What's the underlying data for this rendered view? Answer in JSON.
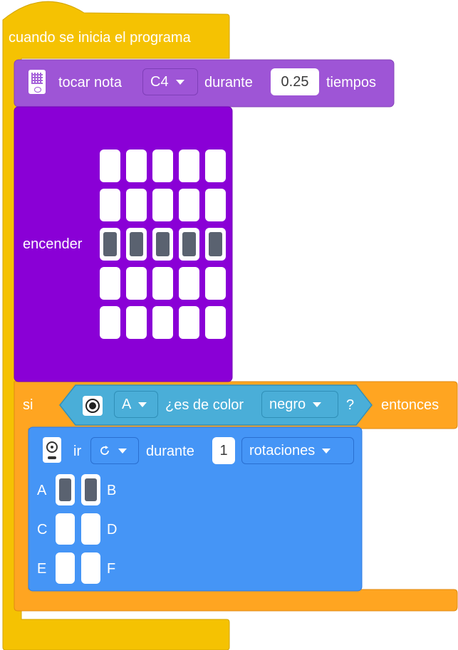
{
  "colors": {
    "event": "#f5c202",
    "event_dark": "#d4a600",
    "sound": "#9e55d6",
    "sound_dark": "#8444b8",
    "display": "#8a00d6",
    "display_dark": "#7200b5",
    "control": "#ffa521",
    "control_dark": "#e08a12",
    "sensor": "#4aaed8",
    "sensor_dark": "#3490b8",
    "motor": "#4595f6",
    "motor_dark": "#2f7be0"
  },
  "hat_block": {
    "label": "cuando se inicia el programa"
  },
  "play_note": {
    "icon": "hub-speaker-icon",
    "prefix": "tocar nota",
    "note": "C4",
    "middle": "durante",
    "beats": "0.25",
    "suffix": "tiempos"
  },
  "light_matrix": {
    "label": "encender",
    "grid": [
      [
        false,
        false,
        false,
        false,
        false
      ],
      [
        false,
        false,
        false,
        false,
        false
      ],
      [
        true,
        true,
        true,
        true,
        true
      ],
      [
        false,
        false,
        false,
        false,
        false
      ],
      [
        false,
        false,
        false,
        false,
        false
      ]
    ]
  },
  "if_block": {
    "prefix": "si",
    "suffix": "entonces",
    "condition": {
      "icon": "color-sensor-icon",
      "port": "A",
      "text": "¿es de color",
      "color_value": "negro",
      "question": "?"
    }
  },
  "motor_block": {
    "icon": "motor-pair-icon",
    "verb": "ir",
    "direction_icon": "rotate-clockwise-icon",
    "middle": "durante",
    "amount": "1",
    "unit": "rotaciones",
    "ports": [
      {
        "left": "A",
        "right": "B",
        "left_on": true,
        "right_on": true
      },
      {
        "left": "C",
        "right": "D",
        "left_on": false,
        "right_on": false
      },
      {
        "left": "E",
        "right": "F",
        "left_on": false,
        "right_on": false
      }
    ]
  }
}
